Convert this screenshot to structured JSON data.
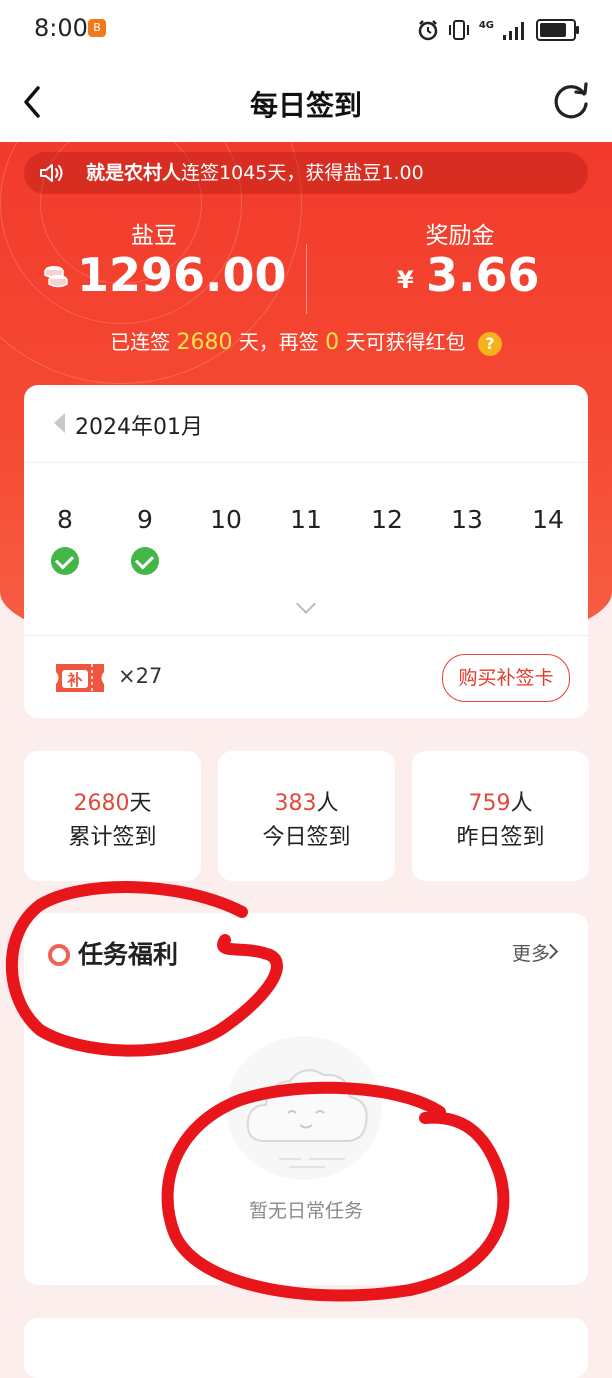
{
  "status_bar": {
    "time": "8:00",
    "network": "4G",
    "app_badge": "B"
  },
  "nav": {
    "title": "每日签到"
  },
  "notice": {
    "name": "就是农村人",
    "text": "连签1045天，获得盐豆1.00"
  },
  "balance": {
    "beans_label": "盐豆",
    "beans_value": "1296.00",
    "bonus_label": "奖励金",
    "currency": "¥",
    "bonus_value": "3.66"
  },
  "streak": {
    "prefix": "已连签",
    "days": "2680",
    "middle": "天，再签",
    "remain": "0",
    "suffix": "天可获得红包",
    "help": "?"
  },
  "calendar": {
    "month": "2024年01月",
    "days": [
      {
        "day": "8",
        "signed": true
      },
      {
        "day": "9",
        "signed": true
      },
      {
        "day": "10",
        "signed": false
      },
      {
        "day": "11",
        "signed": false
      },
      {
        "day": "12",
        "signed": false
      },
      {
        "day": "13",
        "signed": false
      },
      {
        "day": "14",
        "signed": false
      }
    ],
    "ticket_label": "补",
    "ticket_count": "×27",
    "buy_button": "购买补签卡"
  },
  "stats": [
    {
      "value": "2680",
      "unit": "天",
      "caption": "累计签到"
    },
    {
      "value": "383",
      "unit": "人",
      "caption": "今日签到"
    },
    {
      "value": "759",
      "unit": "人",
      "caption": "昨日签到"
    }
  ],
  "tasks": {
    "title": "任务福利",
    "more": "更多",
    "empty": "暂无日常任务"
  },
  "colors": {
    "brand_red": "#f23a2c",
    "highlight_yellow": "#ffe14a",
    "check_green": "#44b549",
    "annotation_red": "#e8161b"
  }
}
